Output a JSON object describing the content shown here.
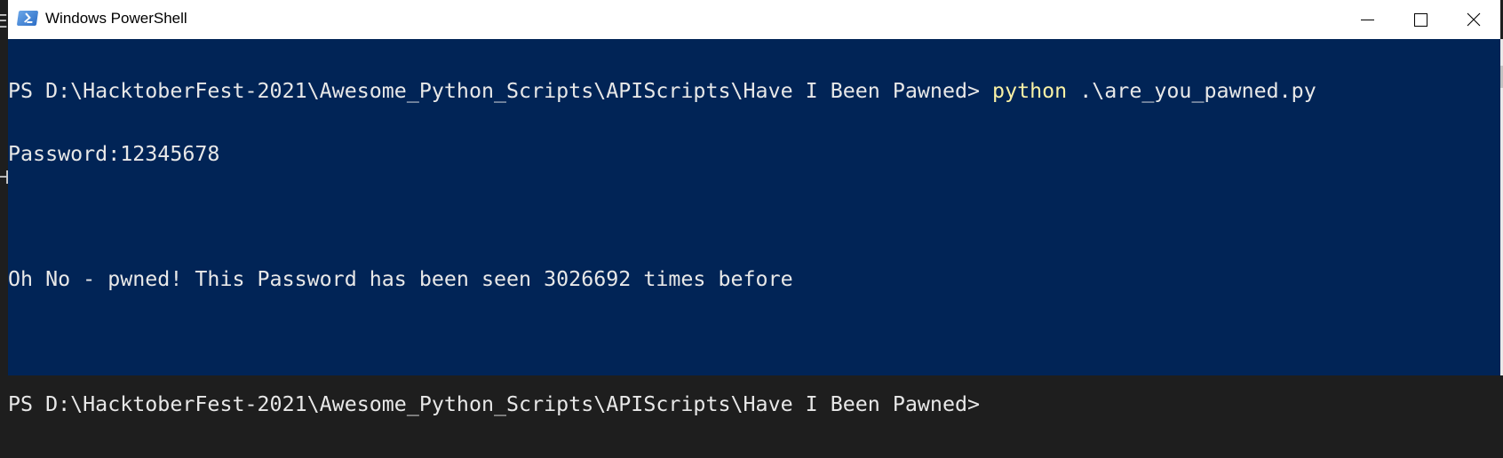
{
  "window": {
    "title": "Windows PowerShell",
    "icon": "powershell-icon"
  },
  "controls": {
    "minimize": "minimize-icon",
    "maximize": "maximize-icon",
    "close": "close-icon"
  },
  "colors": {
    "background": "#012456",
    "text": "#e8e8e8",
    "command": "#f9f1a5"
  },
  "terminal": {
    "line1_prompt": "PS D:\\HacktoberFest-2021\\Awesome_Python_Scripts\\APIScripts\\Have I Been Pawned> ",
    "line1_command": "python",
    "line1_args": " .\\are_you_pawned.py",
    "line2": "Password:12345678",
    "line3": "",
    "line4": "Oh No - pwned! This Password has been seen 3026692 times before",
    "line5": "",
    "line6_prompt": "PS D:\\HacktoberFest-2021\\Awesome_Python_Scripts\\APIScripts\\Have I Been Pawned>"
  }
}
